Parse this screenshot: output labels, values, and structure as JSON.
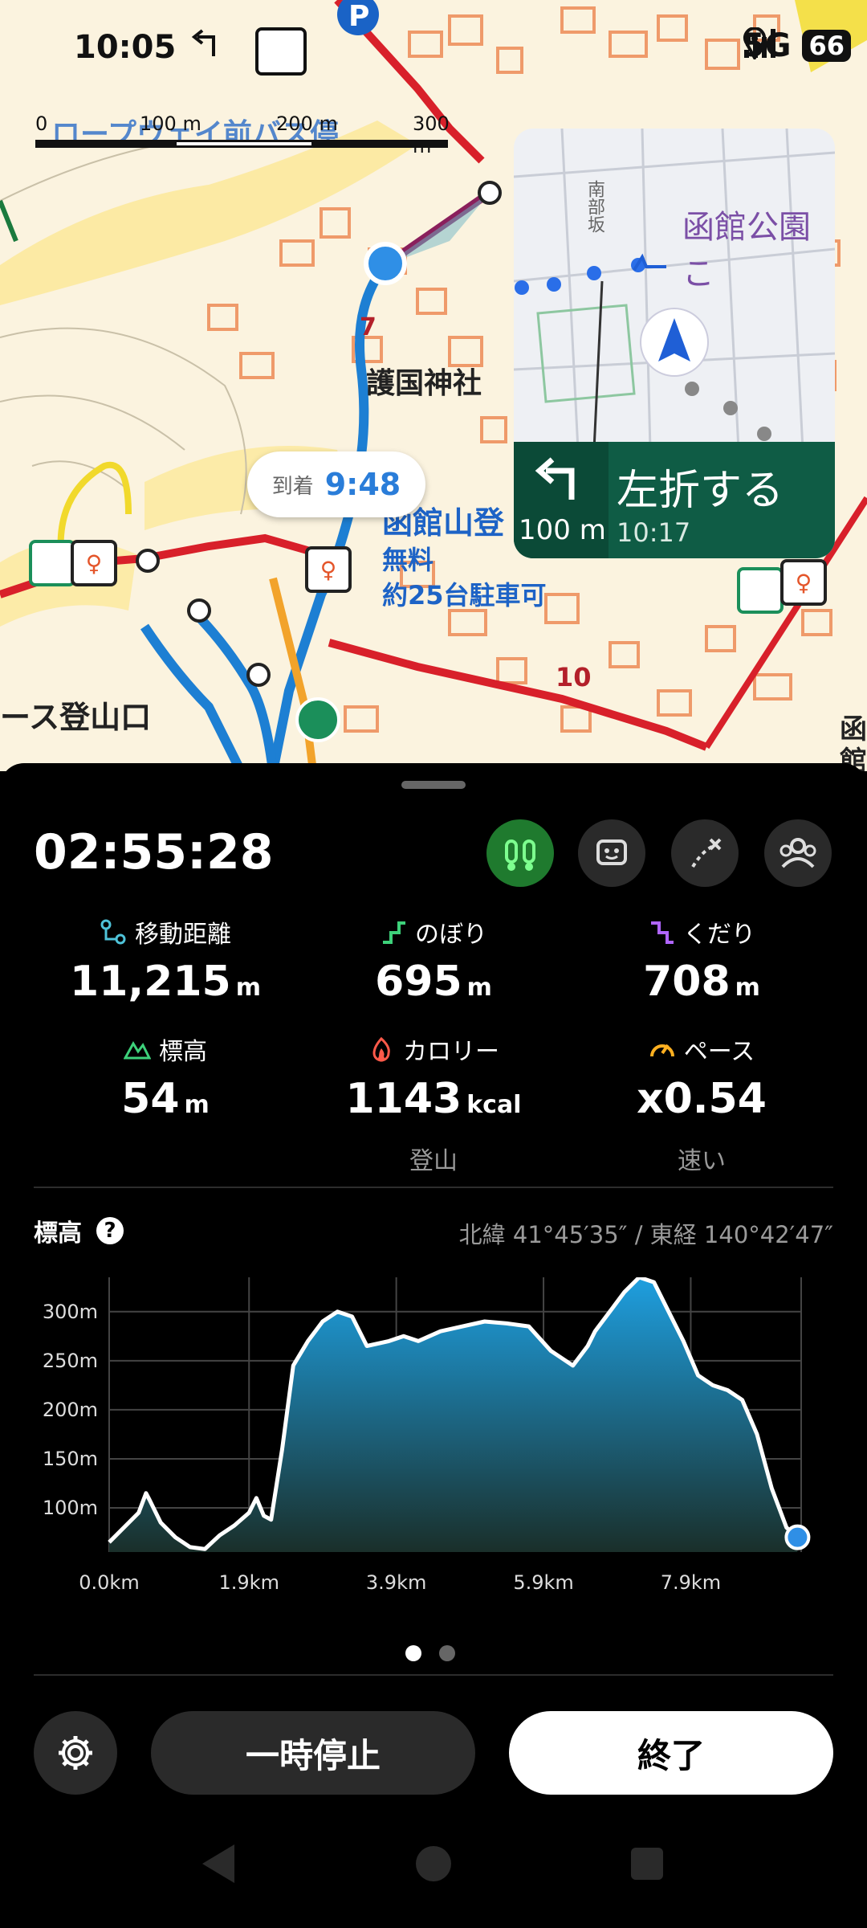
{
  "status_bar": {
    "time": "10:05",
    "network": "5G",
    "battery": "66"
  },
  "map": {
    "scale_labels": [
      "0",
      "100 m",
      "200 m",
      "300 m"
    ],
    "label_shrine": "護国神社",
    "label_mountain": "函館山登",
    "label_free": "無料",
    "label_parking": "約25台駐車可",
    "label_trailhead": "ース登山口",
    "route_num_7": "7",
    "route_num_10": "10",
    "label_hako": "函",
    "label_kan": "館",
    "label_ropeway": "ロープウェイ前バス停"
  },
  "arrival": {
    "label": "到着",
    "time": "9:48"
  },
  "minimap": {
    "street_label": "函館公園こ",
    "street_side": "南部坂",
    "turn_instruction": "左折する",
    "turn_distance": "100 m",
    "turn_time": "10:17"
  },
  "activity": {
    "elapsed_time": "02:55:28",
    "stats": [
      {
        "label": "移動距離",
        "value": "11,215",
        "unit": "m",
        "icon": "distance-icon",
        "color": "#4fc3d9"
      },
      {
        "label": "のぼり",
        "value": "695",
        "unit": "m",
        "icon": "ascent-icon",
        "color": "#3dd17a"
      },
      {
        "label": "くだり",
        "value": "708",
        "unit": "m",
        "icon": "descent-icon",
        "color": "#b065ff"
      },
      {
        "label": "標高",
        "value": "54",
        "unit": "m",
        "icon": "elevation-icon",
        "color": "#3dd17a"
      },
      {
        "label": "カロリー",
        "value": "1143",
        "unit": "kcal",
        "icon": "calorie-icon",
        "color": "#ff5a4a",
        "sub": "登山"
      },
      {
        "label": "ペース",
        "value": "x0.54",
        "unit": "",
        "icon": "pace-icon",
        "color": "#ffb020",
        "sub": "速い"
      }
    ]
  },
  "elevation": {
    "title": "標高",
    "coordinates": "北緯 41°45′35″ / 東経 140°42′47″"
  },
  "buttons": {
    "pause": "一時停止",
    "end": "終了"
  },
  "chart_data": {
    "type": "area",
    "x_unit": "km",
    "y_unit": "m",
    "x_ticks": [
      "0.0km",
      "1.9km",
      "3.9km",
      "5.9km",
      "7.9km"
    ],
    "y_ticks": [
      "100m",
      "150m",
      "200m",
      "250m",
      "300m"
    ],
    "xlim": [
      0,
      9.4
    ],
    "ylim": [
      55,
      335
    ],
    "grid": true,
    "x": [
      0,
      0.4,
      0.5,
      0.55,
      0.7,
      0.9,
      1.1,
      1.3,
      1.5,
      1.7,
      1.9,
      2.0,
      2.1,
      2.2,
      2.35,
      2.5,
      2.7,
      2.9,
      3.1,
      3.3,
      3.5,
      3.8,
      4.0,
      4.2,
      4.5,
      4.8,
      5.1,
      5.4,
      5.7,
      6.0,
      6.3,
      6.5,
      6.6,
      6.8,
      7.0,
      7.2,
      7.4,
      7.6,
      7.8,
      8.0,
      8.2,
      8.4,
      8.6,
      8.8,
      9.0,
      9.2,
      9.35
    ],
    "values": [
      65,
      95,
      115,
      108,
      85,
      70,
      60,
      58,
      72,
      82,
      95,
      110,
      92,
      88,
      160,
      245,
      270,
      290,
      300,
      295,
      265,
      270,
      275,
      270,
      280,
      285,
      290,
      288,
      285,
      260,
      245,
      265,
      280,
      300,
      320,
      335,
      330,
      300,
      270,
      235,
      225,
      220,
      210,
      175,
      120,
      80,
      70
    ]
  }
}
